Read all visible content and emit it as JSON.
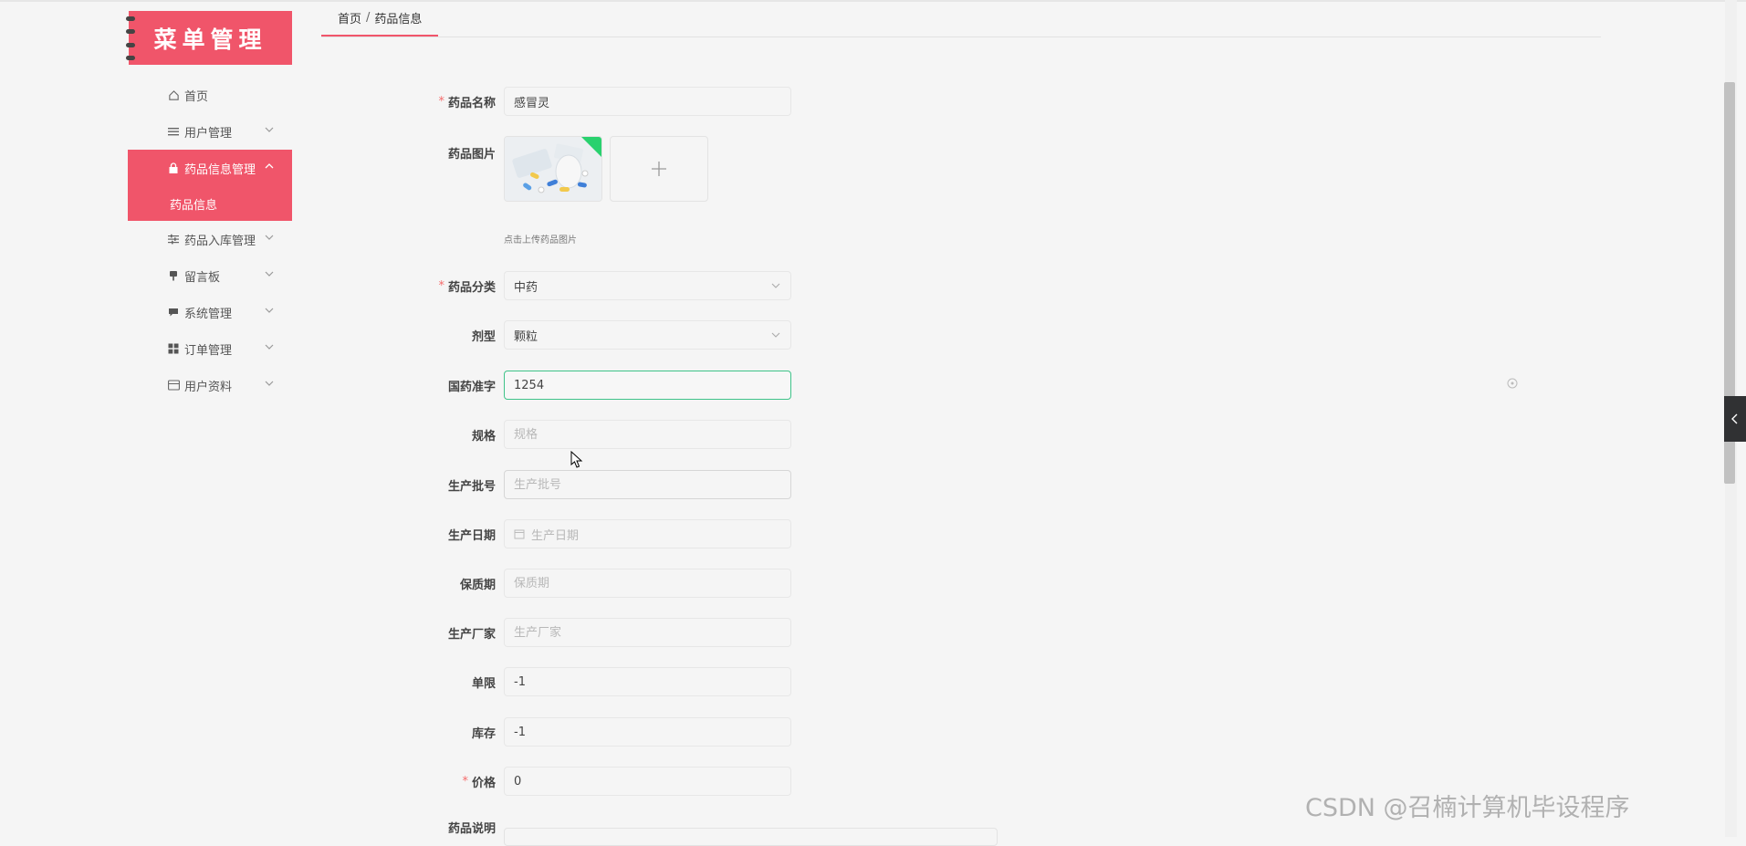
{
  "app": {
    "logo_text": "菜单管理",
    "watermark": "CSDN @召楠计算机毕设程序"
  },
  "colors": {
    "accent": "#f0556a",
    "focus_border": "#3fc389",
    "required": "#f56c6c"
  },
  "sidebar": {
    "items": [
      {
        "label": "首页",
        "icon": "home-icon"
      },
      {
        "label": "用户管理",
        "icon": "list-icon"
      },
      {
        "label": "药品信息管理",
        "icon": "lock-icon",
        "active": true
      },
      {
        "label": "药品入库管理",
        "icon": "sliders-icon"
      },
      {
        "label": "留言板",
        "icon": "pin-icon"
      },
      {
        "label": "系统管理",
        "icon": "chat-icon"
      },
      {
        "label": "订单管理",
        "icon": "grid-icon"
      },
      {
        "label": "用户资料",
        "icon": "card-icon"
      }
    ],
    "submenu": {
      "label": "药品信息"
    }
  },
  "breadcrumb": {
    "home": "首页",
    "separator": "/",
    "current": "药品信息"
  },
  "form": {
    "name": {
      "label": "药品名称",
      "value": "感冒灵"
    },
    "image": {
      "label": "药品图片",
      "tip": "点击上传药品图片"
    },
    "category": {
      "label": "药品分类",
      "value": "中药"
    },
    "dosage_form": {
      "label": "剂型",
      "value": "颗粒"
    },
    "approval": {
      "label": "国药准字",
      "value": "1254"
    },
    "spec": {
      "label": "规格",
      "placeholder": "规格"
    },
    "batch": {
      "label": "生产批号",
      "placeholder": "生产批号"
    },
    "date": {
      "label": "生产日期",
      "placeholder": "生产日期"
    },
    "shelf_life": {
      "label": "保质期",
      "placeholder": "保质期"
    },
    "manufacturer": {
      "label": "生产厂家",
      "placeholder": "生产厂家"
    },
    "limit": {
      "label": "单限",
      "value": "-1"
    },
    "stock": {
      "label": "库存",
      "value": "-1"
    },
    "price": {
      "label": "价格",
      "value": "0"
    },
    "description": {
      "label": "药品说明"
    }
  }
}
